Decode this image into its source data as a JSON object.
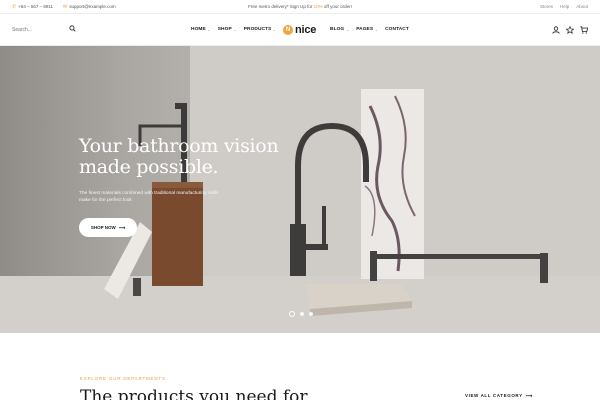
{
  "topbar": {
    "phone": "+84 – 567 – 8911",
    "email": "support@example.com",
    "promo_before": "Free metro delivery* Sign Up for ",
    "promo_highlight": "10%",
    "promo_after": " off your order!",
    "links": [
      "Stores",
      "Help",
      "About"
    ]
  },
  "header": {
    "search_placeholder": "Search...",
    "nav_left": [
      {
        "label": "HOME",
        "dropdown": true
      },
      {
        "label": "SHOP",
        "dropdown": true
      },
      {
        "label": "PRODUCTS",
        "dropdown": true
      }
    ],
    "logo_mark": "N",
    "logo_text": "nice",
    "nav_right": [
      {
        "label": "BLOG",
        "dropdown": true
      },
      {
        "label": "PAGES",
        "dropdown": true
      },
      {
        "label": "CONTACT",
        "dropdown": false
      }
    ],
    "icons": [
      "user-icon",
      "star-icon",
      "cart-icon"
    ]
  },
  "hero": {
    "title": "Your bathroom vision made possible.",
    "subtitle": "The finest materials combined with traditional manufacturing skills make for the perfect look",
    "button_label": "SHOP NOW",
    "slide_count": 3,
    "active_slide": 1
  },
  "section": {
    "eyebrow": "EXPLORE OUR DEPARTMENTS",
    "title": "The products you need for",
    "view_all": "VIEW ALL CATEGORY"
  },
  "colors": {
    "accent": "#f2a33a",
    "text": "#1a1a1a"
  }
}
